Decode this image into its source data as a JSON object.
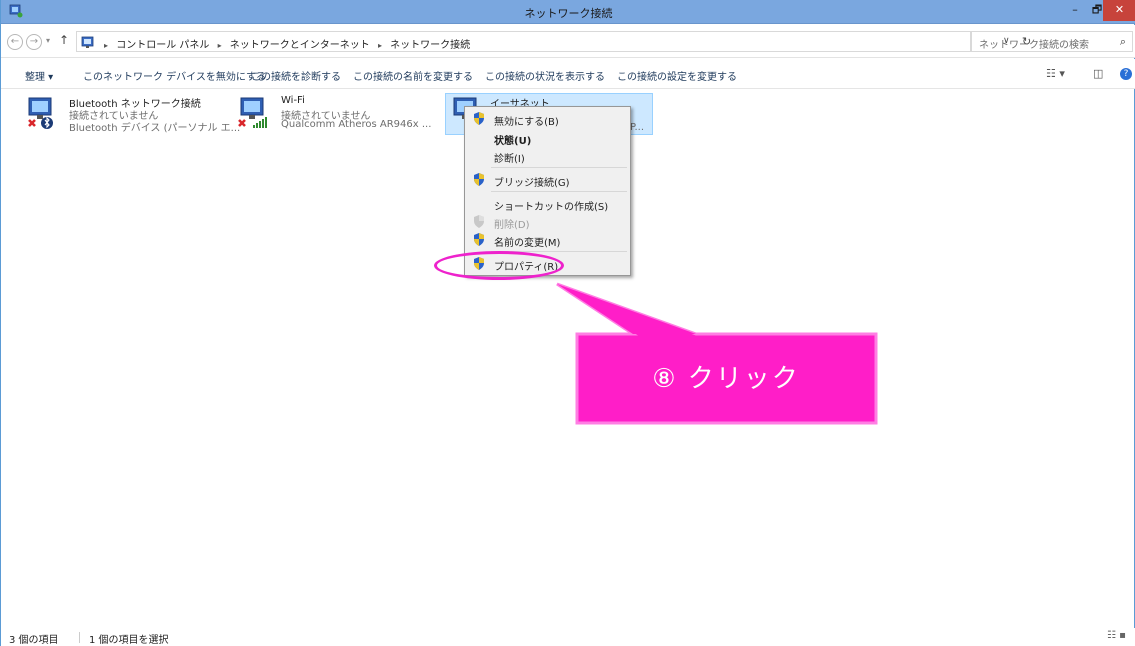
{
  "window": {
    "title": "ネットワーク接続",
    "minimize": "–",
    "maximize": "🗗",
    "close": "✕"
  },
  "address": {
    "back": "←",
    "forward": "→",
    "recent": "▾",
    "up": "↑",
    "crumbs": [
      "コントロール パネル",
      "ネットワークとインターネット",
      "ネットワーク接続"
    ],
    "crumb_sep": "▸",
    "dropdown": "∨",
    "refresh": "↻",
    "search_placeholder": "ネットワーク接続の検索",
    "search_icon": "⌕"
  },
  "toolbar": {
    "organize": "整理 ▾",
    "disable": "このネットワーク デバイスを無効にする",
    "diagnose": "この接続を診断する",
    "rename": "この接続の名前を変更する",
    "status": "この接続の状況を表示する",
    "settings": "この接続の設定を変更する",
    "view": "☷ ▾",
    "pane": "◫",
    "help": "?"
  },
  "items": [
    {
      "name": "Bluetooth ネットワーク接続",
      "status": "接続されていません",
      "device": "Bluetooth デバイス (パーソナル エ..."
    },
    {
      "name": "Wi-Fi",
      "status": "接続されていません",
      "device": "Qualcomm Atheros AR946x ..."
    },
    {
      "name": "イーサネット",
      "status": "",
      "device": "P..."
    }
  ],
  "context_menu": {
    "disable": "無効にする(B)",
    "status": "状態(U)",
    "diagnose": "診断(I)",
    "bridge": "ブリッジ接続(G)",
    "shortcut": "ショートカットの作成(S)",
    "delete": "削除(D)",
    "rename": "名前の変更(M)",
    "properties": "プロパティ(R)"
  },
  "annotation": {
    "text": "⑧ クリック",
    "color": "#ff1ec8"
  },
  "statusbar": {
    "count": "3 個の項目",
    "selected": "1 個の項目を選択",
    "view_icons": "☷ ▪"
  },
  "colors": {
    "titlebar": "#7aa7df",
    "close": "#c7433b",
    "selection": "#cde8ff",
    "annotation": "#ff1ec8"
  }
}
